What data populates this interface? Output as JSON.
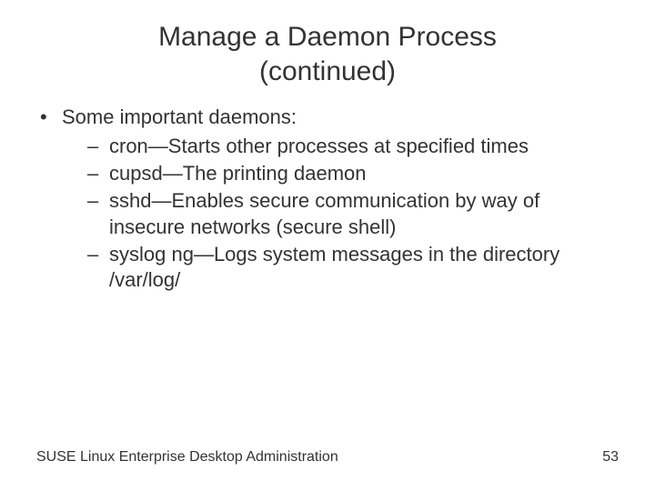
{
  "title": {
    "line1": "Manage a Daemon Process",
    "line2": "(continued)"
  },
  "bullets": {
    "intro": "Some important daemons:",
    "items": [
      "cron—Starts other processes at specified times",
      "cupsd—The printing daemon",
      "sshd—Enables secure communication by way of insecure networks (secure shell)",
      "syslog ng—Logs system messages in the directory /var/log/"
    ]
  },
  "footer": {
    "text": "SUSE Linux Enterprise Desktop Administration",
    "page": "53"
  }
}
